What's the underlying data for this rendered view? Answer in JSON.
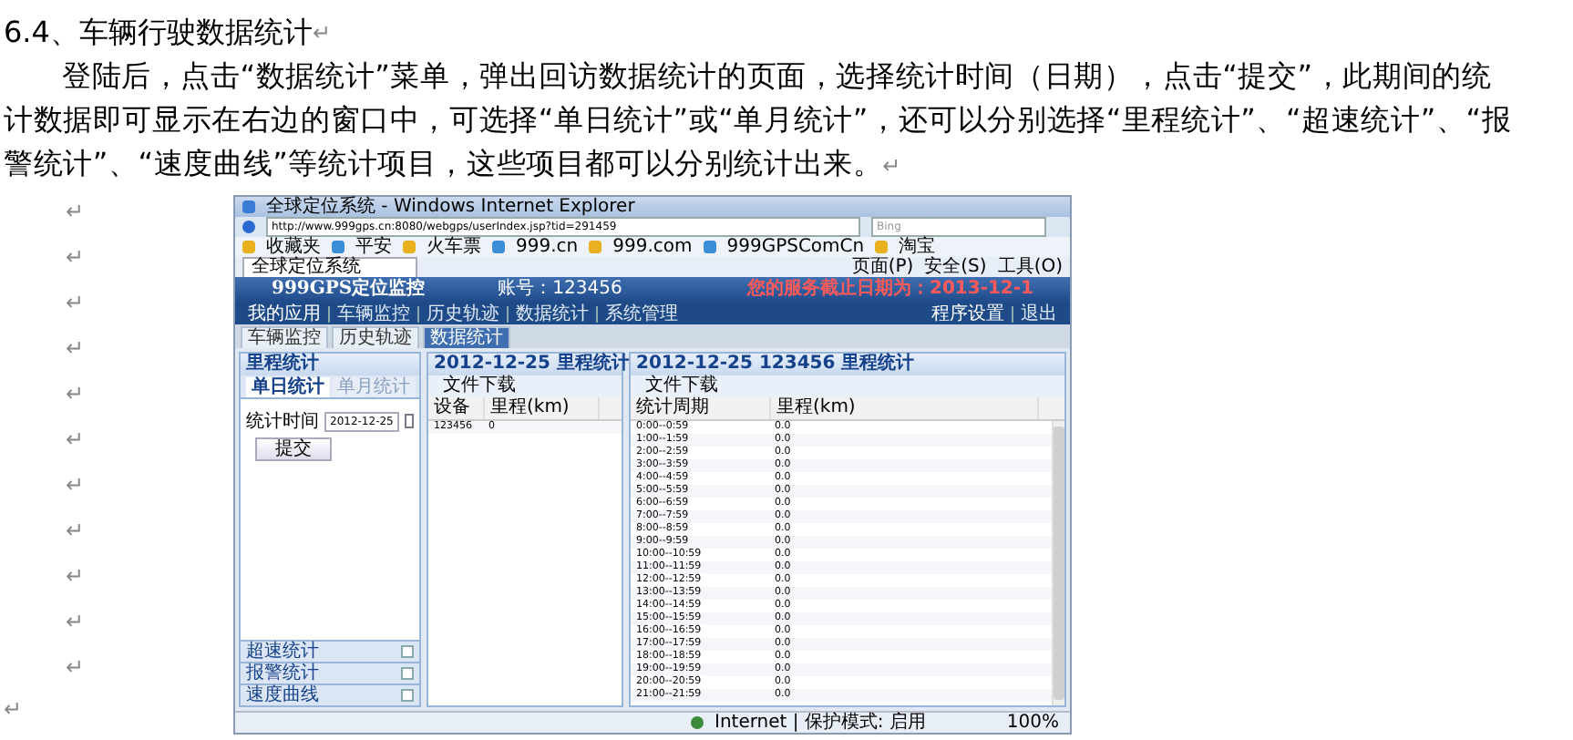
{
  "heading": {
    "text": "6.4、车辆行驶数据统计",
    "mark": "↵"
  },
  "paragraph": {
    "text": "登陆后，点击“数据统计”菜单，弹出回访数据统计的页面，选择统计时间（日期），点击“提交”，此期间的统计数据即可显示在右边的窗口中，可选择“单日统计”或“单月统计”，还可以分别选择“里程统计”、“超速统计”、“报警统计”、“速度曲线”等统计项目，这些项目都可以分别统计出来。",
    "mark": "↵"
  },
  "blank_marks": [
    "↵",
    "↵",
    "↵",
    "↵",
    "↵",
    "↵",
    "↵",
    "↵",
    "↵",
    "↵",
    "↵"
  ],
  "final_mark": "↵",
  "screenshot": {
    "window_title": "全球定位系统 - Windows Internet Explorer",
    "address": "http://www.999gps.cn:8080/webgps/userIndex.jsp?tid=291459",
    "search_placeholder": "Bing",
    "favorites": [
      "收藏夹",
      "平安",
      "火车票",
      "999.cn",
      "999.com",
      "999GPSComCn",
      "淘宝"
    ],
    "browser_tab": "全球定位系统",
    "command_menus": [
      "页面(P)",
      "安全(S)",
      "工具(O)"
    ],
    "app": {
      "title": "999GPS定位监控",
      "user": "账号：123456",
      "notice": "您的服务截止日期为：2013-12-1",
      "nav": [
        "我的应用",
        "车辆监控",
        "历史轨迹",
        "数据统计",
        "系统管理"
      ],
      "nav_right": [
        "程序设置",
        "退出"
      ],
      "tabs": [
        {
          "label": "车辆监控",
          "selected": false
        },
        {
          "label": "历史轨迹",
          "selected": false
        },
        {
          "label": "数据统计",
          "selected": true
        }
      ],
      "left_panel": {
        "title": "里程统计",
        "subtabs": [
          {
            "label": "单日统计",
            "selected": true
          },
          {
            "label": "单月统计",
            "selected": false
          }
        ],
        "date_label": "统计时间",
        "date_value": "2012-12-25",
        "submit": "提交",
        "collapsed": [
          "超速统计",
          "报警统计",
          "速度曲线"
        ]
      },
      "middle_panel": {
        "title": "2012-12-25 里程统计",
        "download": "文件下载",
        "columns": [
          "设备",
          "里程(km)"
        ],
        "rows": [
          [
            "123456",
            "0"
          ]
        ]
      },
      "right_panel": {
        "title": "2012-12-25 123456 里程统计",
        "download": "文件下载",
        "columns": [
          "统计周期",
          "里程(km)"
        ],
        "rows": [
          [
            "0:00--0:59",
            "0.0"
          ],
          [
            "1:00--1:59",
            "0.0"
          ],
          [
            "2:00--2:59",
            "0.0"
          ],
          [
            "3:00--3:59",
            "0.0"
          ],
          [
            "4:00--4:59",
            "0.0"
          ],
          [
            "5:00--5:59",
            "0.0"
          ],
          [
            "6:00--6:59",
            "0.0"
          ],
          [
            "7:00--7:59",
            "0.0"
          ],
          [
            "8:00--8:59",
            "0.0"
          ],
          [
            "9:00--9:59",
            "0.0"
          ],
          [
            "10:00--10:59",
            "0.0"
          ],
          [
            "11:00--11:59",
            "0.0"
          ],
          [
            "12:00--12:59",
            "0.0"
          ],
          [
            "13:00--13:59",
            "0.0"
          ],
          [
            "14:00--14:59",
            "0.0"
          ],
          [
            "15:00--15:59",
            "0.0"
          ],
          [
            "16:00--16:59",
            "0.0"
          ],
          [
            "17:00--17:59",
            "0.0"
          ],
          [
            "18:00--18:59",
            "0.0"
          ],
          [
            "19:00--19:59",
            "0.0"
          ],
          [
            "20:00--20:59",
            "0.0"
          ],
          [
            "21:00--21:59",
            "0.0"
          ]
        ]
      }
    },
    "status": {
      "zone": "Internet | 保护模式: 启用",
      "zoom": "100%"
    }
  }
}
